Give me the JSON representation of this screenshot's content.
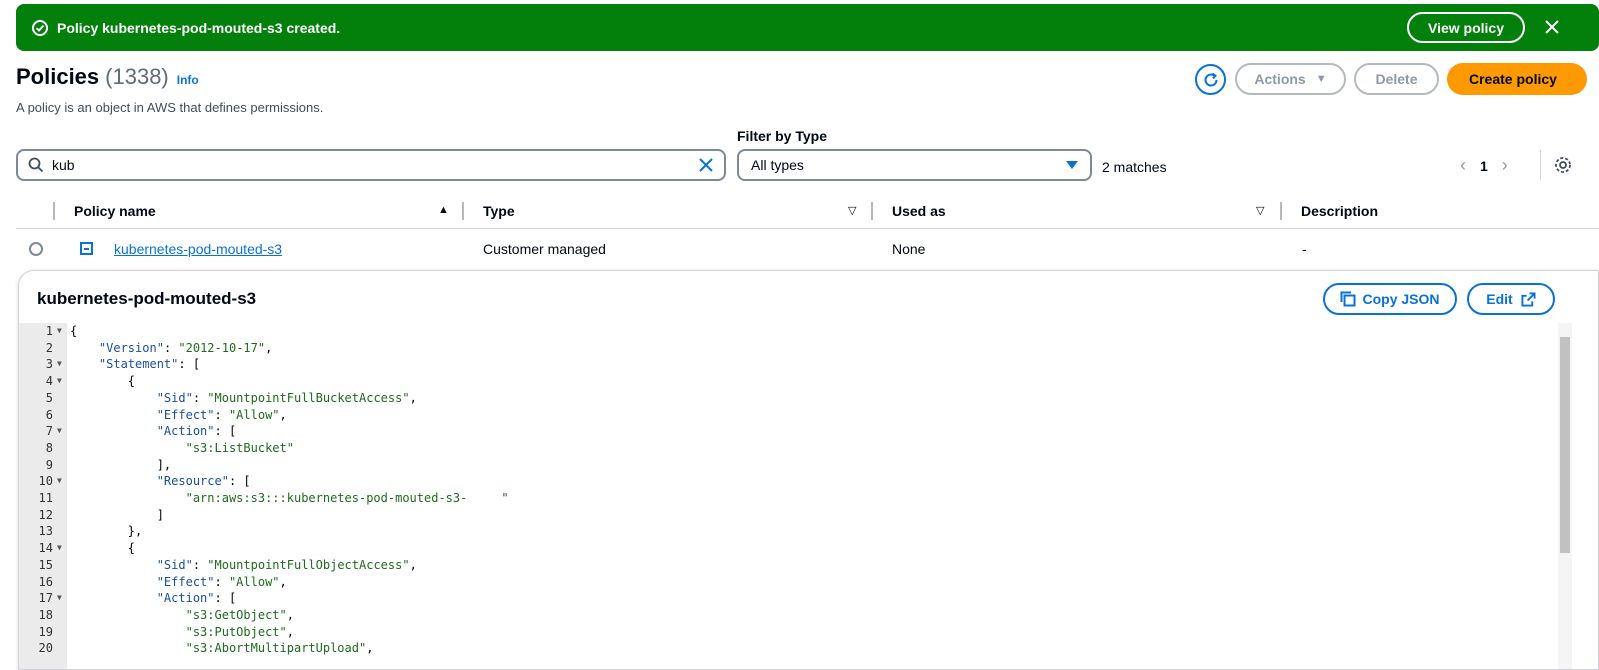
{
  "flash": {
    "message": "Policy kubernetes-pod-mouted-s3 created.",
    "view_label": "View policy",
    "close_glyph": "✕"
  },
  "header": {
    "title": "Policies",
    "count": "(1338)",
    "info": "Info",
    "description": "A policy is an object in AWS that defines permissions.",
    "actions_label": "Actions",
    "delete_label": "Delete",
    "create_label": "Create policy"
  },
  "filters": {
    "search_value": "kub",
    "type_label": "Filter by Type",
    "type_value": "All types",
    "matches": "2 matches"
  },
  "pagination": {
    "prev": "‹",
    "page": "1",
    "next": "›"
  },
  "table": {
    "columns": [
      "Policy name",
      "Type",
      "Used as",
      "Description"
    ],
    "rows": [
      {
        "name": "kubernetes-pod-mouted-s3",
        "type": "Customer managed",
        "used_as": "None",
        "description": "-"
      }
    ]
  },
  "detail": {
    "title": "kubernetes-pod-mouted-s3",
    "copy_label": "Copy JSON",
    "edit_label": "Edit",
    "lines": [
      {
        "n": "1",
        "fold": true,
        "text": "{"
      },
      {
        "n": "2",
        "fold": false,
        "text": "    \"Version\": \"2012-10-17\","
      },
      {
        "n": "3",
        "fold": true,
        "text": "    \"Statement\": ["
      },
      {
        "n": "4",
        "fold": true,
        "text": "        {"
      },
      {
        "n": "5",
        "fold": false,
        "text": "            \"Sid\": \"MountpointFullBucketAccess\","
      },
      {
        "n": "6",
        "fold": false,
        "text": "            \"Effect\": \"Allow\","
      },
      {
        "n": "7",
        "fold": true,
        "text": "            \"Action\": ["
      },
      {
        "n": "8",
        "fold": false,
        "text": "                \"s3:ListBucket\""
      },
      {
        "n": "9",
        "fold": false,
        "text": "            ],"
      },
      {
        "n": "10",
        "fold": true,
        "text": "            \"Resource\": ["
      },
      {
        "n": "11",
        "fold": false,
        "text": "                \"arn:aws:s3:::kubernetes-pod-mouted-s3-     \""
      },
      {
        "n": "12",
        "fold": false,
        "text": "            ]"
      },
      {
        "n": "13",
        "fold": false,
        "text": "        },"
      },
      {
        "n": "14",
        "fold": true,
        "text": "        {"
      },
      {
        "n": "15",
        "fold": false,
        "text": "            \"Sid\": \"MountpointFullObjectAccess\","
      },
      {
        "n": "16",
        "fold": false,
        "text": "            \"Effect\": \"Allow\","
      },
      {
        "n": "17",
        "fold": true,
        "text": "            \"Action\": ["
      },
      {
        "n": "18",
        "fold": false,
        "text": "                \"s3:GetObject\","
      },
      {
        "n": "19",
        "fold": false,
        "text": "                \"s3:PutObject\","
      },
      {
        "n": "20",
        "fold": false,
        "text": "                \"s3:AbortMultipartUpload\","
      }
    ]
  },
  "colors": {
    "success": "#037f0c",
    "primary": "#ff9900",
    "link": "#0972d3"
  }
}
